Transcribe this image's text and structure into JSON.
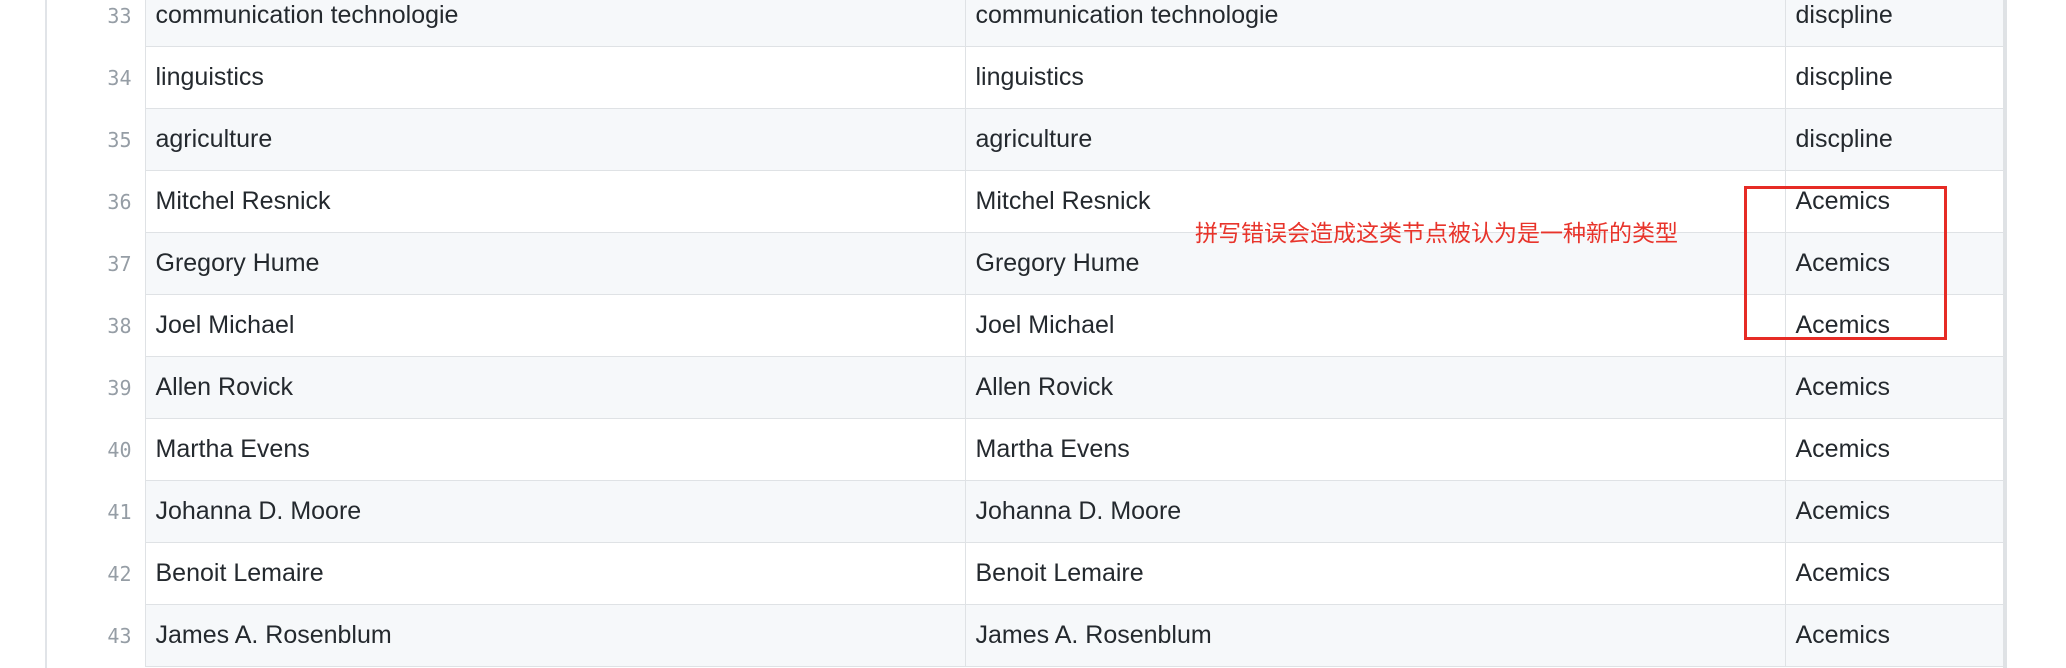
{
  "table": {
    "rows": [
      {
        "num": "33",
        "c1": "communication technologie",
        "c2": "communication technologie",
        "c3": "discpline",
        "alt": true
      },
      {
        "num": "34",
        "c1": "linguistics",
        "c2": "linguistics",
        "c3": "discpline",
        "alt": false
      },
      {
        "num": "35",
        "c1": "agriculture",
        "c2": "agriculture",
        "c3": "discpline",
        "alt": true
      },
      {
        "num": "36",
        "c1": "Mitchel Resnick",
        "c2": "Mitchel Resnick",
        "c3": "Acemics",
        "alt": false
      },
      {
        "num": "37",
        "c1": "Gregory Hume",
        "c2": "Gregory Hume",
        "c3": "Acemics",
        "alt": true
      },
      {
        "num": "38",
        "c1": "Joel Michael",
        "c2": "Joel Michael",
        "c3": "Acemics",
        "alt": false
      },
      {
        "num": "39",
        "c1": "Allen Rovick",
        "c2": "Allen Rovick",
        "c3": "Acemics",
        "alt": true
      },
      {
        "num": "40",
        "c1": "Martha Evens",
        "c2": "Martha Evens",
        "c3": "Acemics",
        "alt": false
      },
      {
        "num": "41",
        "c1": "Johanna D. Moore",
        "c2": "Johanna D. Moore",
        "c3": "Acemics",
        "alt": true
      },
      {
        "num": "42",
        "c1": "Benoit Lemaire",
        "c2": "Benoit Lemaire",
        "c3": "Acemics",
        "alt": false
      },
      {
        "num": "43",
        "c1": "James A. Rosenblum",
        "c2": "James A. Rosenblum",
        "c3": "Acemics",
        "alt": true
      }
    ]
  },
  "annotation": {
    "text": "拼写错误会造成这类节点被认为是一种新的类型",
    "color": "#e8342b"
  },
  "colors": {
    "row_alt": "#f6f8fa",
    "border": "#dfe2e5",
    "line_number": "#959da5",
    "text": "#24292e"
  }
}
